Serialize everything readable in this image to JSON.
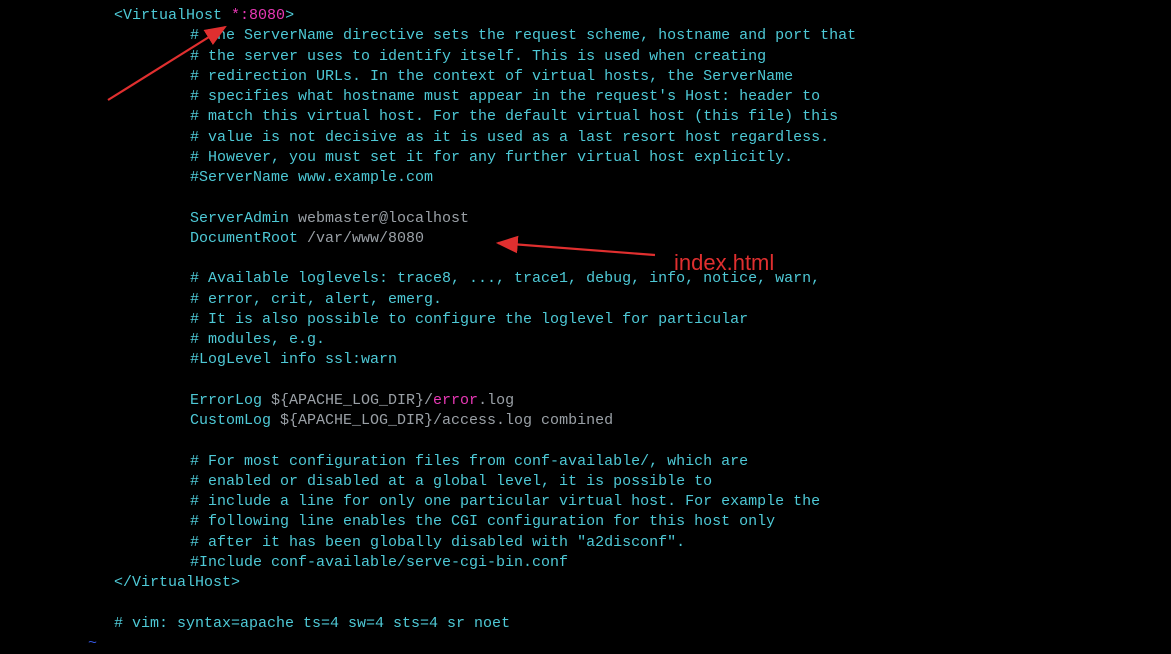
{
  "tag_open": {
    "lt": "<",
    "name": "VirtualHost",
    "args": " *:8080",
    "gt": ">"
  },
  "tag_close": {
    "lt": "</",
    "name": "VirtualHost",
    "gt": ">"
  },
  "comments_block1": [
    "# The ServerName directive sets the request scheme, hostname and port that",
    "# the server uses to identify itself. This is used when creating",
    "# redirection URLs. In the context of virtual hosts, the ServerName",
    "# specifies what hostname must appear in the request's Host: header to",
    "# match this virtual host. For the default virtual host (this file) this",
    "# value is not decisive as it is used as a last resort host regardless.",
    "# However, you must set it for any further virtual host explicitly.",
    "#ServerName www.example.com"
  ],
  "server_admin": {
    "key": "ServerAdmin",
    "val": " webmaster@localhost"
  },
  "document_root": {
    "key": "DocumentRoot",
    "val": " /var/www/8080"
  },
  "comments_block2": [
    "# Available loglevels: trace8, ..., trace1, debug, info, notice, warn,",
    "# error, crit, alert, emerg.",
    "# It is also possible to configure the loglevel for particular",
    "# modules, e.g.",
    "#LogLevel info ssl:warn"
  ],
  "error_log": {
    "key": "ErrorLog",
    "var": " ${APACHE_LOG_DIR}/",
    "file": "error",
    "ext": ".log"
  },
  "custom_log": {
    "key": "CustomLog",
    "rest": " ${APACHE_LOG_DIR}/access.log combined"
  },
  "comments_block3": [
    "# For most configuration files from conf-available/, which are",
    "# enabled or disabled at a global level, it is possible to",
    "# include a line for only one particular virtual host. For example the",
    "# following line enables the CGI configuration for this host only",
    "# after it has been globally disabled with \"a2disconf\".",
    "#Include conf-available/serve-cgi-bin.conf"
  ],
  "footer_comment": "# vim: syntax=apache ts=4 sw=4 sts=4 sr noet",
  "tilde": "~",
  "annotation_label": "index.html"
}
